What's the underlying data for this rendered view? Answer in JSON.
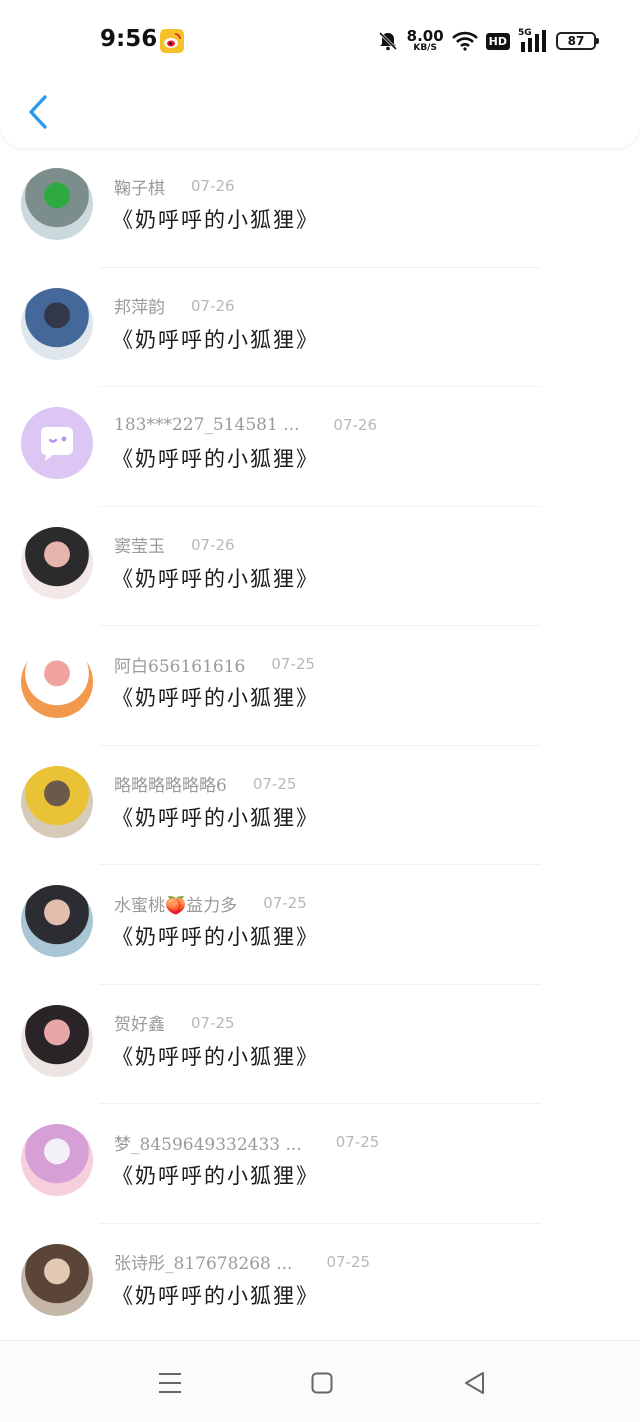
{
  "status_bar": {
    "time": "9:56",
    "net_speed": "8.00",
    "net_unit": "KB/S",
    "hd": "HD",
    "net_type": "5G",
    "battery": "87"
  },
  "comment_text": "《奶呼呼的小狐狸》",
  "rows": [
    {
      "name": "鞠子棋",
      "date": "07-26",
      "avatar_colors": [
        "#cbd9dd",
        "#7b8e8c",
        "#2faa41"
      ]
    },
    {
      "name": "邦萍韵",
      "date": "07-26",
      "avatar_colors": [
        "#dfe6ec",
        "#45689a",
        "#32374a"
      ]
    },
    {
      "name": "183***227_514581 ...",
      "date": "07-26",
      "avatar_colors": [
        "#dcc6f3",
        "#b791ea",
        "#ffffff"
      ]
    },
    {
      "name": "窦莹玉",
      "date": "07-26",
      "avatar_colors": [
        "#f1e8e7",
        "#2b2a2d",
        "#e7b3ad"
      ]
    },
    {
      "name": "阿白656161616",
      "date": "07-25",
      "avatar_colors": [
        "#f2994e",
        "#ffffff",
        "#f0a3a0"
      ]
    },
    {
      "name": "略略略略略略6",
      "date": "07-25",
      "avatar_colors": [
        "#d6cbb9",
        "#e9c235",
        "#6b5a4a"
      ]
    },
    {
      "name": "水蜜桃🍑益力多",
      "date": "07-25",
      "avatar_colors": [
        "#a8c6d4",
        "#2c2c33",
        "#e3bdae"
      ]
    },
    {
      "name": "贺好鑫",
      "date": "07-25",
      "avatar_colors": [
        "#ece4e1",
        "#2a2428",
        "#e8a7a7"
      ]
    },
    {
      "name": "梦_8459649332433 ...",
      "date": "07-25",
      "avatar_colors": [
        "#f6cfdc",
        "#d6a0d6",
        "#f3f0f7"
      ]
    },
    {
      "name": "张诗彤_817678268 ...",
      "date": "07-25",
      "avatar_colors": [
        "#c4b7aa",
        "#5a4538",
        "#e2c9b3"
      ]
    }
  ],
  "colors": {
    "accent": "#2a9bea",
    "name": "#9a9a9a",
    "date": "#b8b8b8"
  },
  "icons": {
    "back": "chevron-left-icon",
    "menu": "menu-icon",
    "home": "square-icon",
    "nav_back": "triangle-back-icon"
  }
}
